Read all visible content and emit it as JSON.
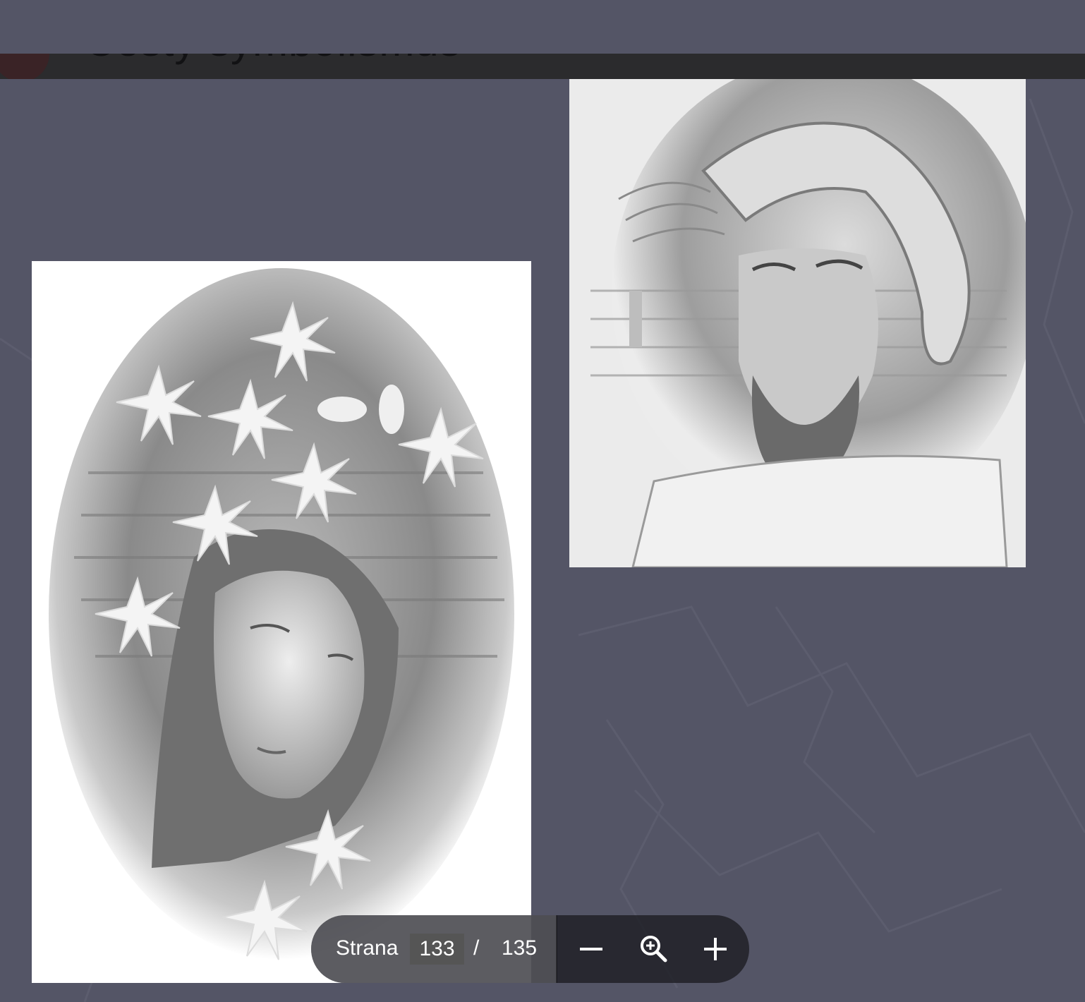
{
  "header": {
    "title": "Cesty symbolismus"
  },
  "slide": {
    "images": [
      {
        "name": "madonna-with-stars-drawing"
      },
      {
        "name": "christ-portrait-drawing"
      }
    ]
  },
  "toolbar": {
    "page_label": "Strana",
    "current_page": "133",
    "separator": "/",
    "total_pages": "135",
    "zoom_out_icon": "minus-icon",
    "zoom_fit_icon": "magnifier-plus-icon",
    "zoom_in_icon": "plus-icon"
  },
  "colors": {
    "background": "#545566",
    "toolbar": "#1e1e24",
    "title_strip": "#2b2b2d"
  }
}
